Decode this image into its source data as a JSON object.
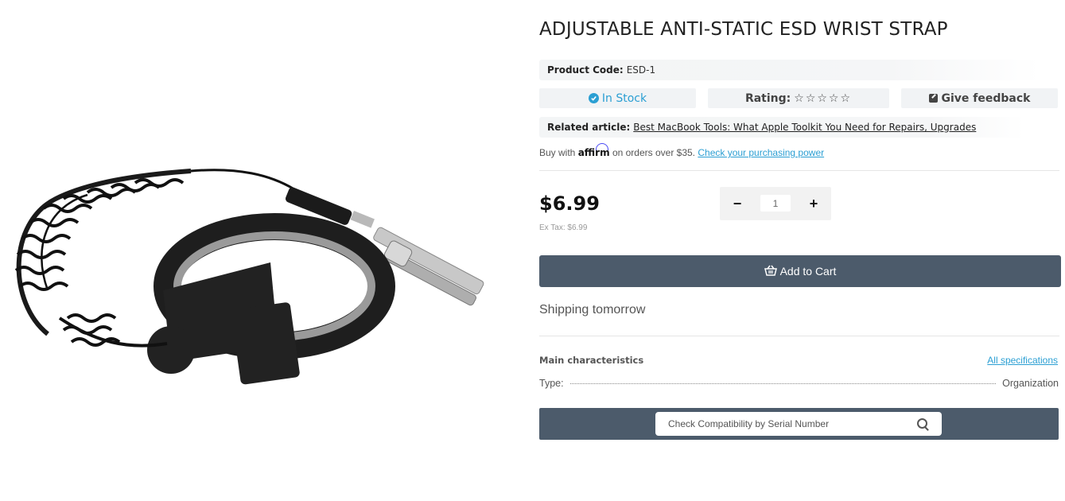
{
  "product": {
    "title": "ADJUSTABLE ANTI-STATIC ESD WRIST STRAP",
    "image_alt": "ESD wrist strap with coiled cord and alligator clip",
    "code_label": "Product Code:",
    "code_value": "ESD-1"
  },
  "status": {
    "stock": "In Stock",
    "rating_label": "Rating:",
    "rating_stars": "☆☆☆☆☆",
    "rating_value": 0,
    "rating_max": 5,
    "feedback": "Give feedback"
  },
  "article": {
    "label": "Related article:",
    "link": "Best MacBook Tools: What Apple Toolkit You Need for Repairs, Upgrades"
  },
  "affirm": {
    "prefix": "Buy with",
    "brand": "affirm",
    "suffix": "on orders over $35.",
    "link": "Check your purchasing power"
  },
  "pricing": {
    "price": "$6.99",
    "ex_tax": "Ex Tax: $6.99"
  },
  "quantity": {
    "minus": "−",
    "plus": "+",
    "value": "1"
  },
  "cart": {
    "button": "Add to Cart"
  },
  "shipping": "Shipping tomorrow",
  "characteristics": {
    "heading": "Main characteristics",
    "all_link": "All specifications",
    "rows": [
      {
        "label": "Type:",
        "value": "Organization"
      }
    ]
  },
  "compatibility": {
    "placeholder": "Check Compatibility by Serial Number"
  },
  "colors": {
    "accent": "#2b9fd3",
    "button_bg": "#4c5b6b",
    "pill_bg": "#f1f3f5"
  }
}
